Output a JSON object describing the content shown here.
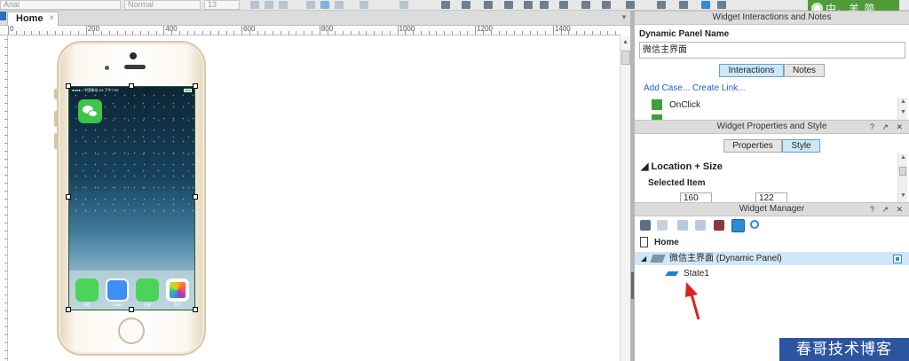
{
  "toolbar": {
    "font_family": "Arial",
    "font_style": "Normal",
    "font_size": "13"
  },
  "logo": {
    "text": "中。羊 简"
  },
  "document_tab": {
    "label": "Home",
    "close": "×"
  },
  "ruler": {
    "labels": [
      "0",
      "200",
      "400",
      "600",
      "800",
      "1000",
      "1200",
      "1400"
    ]
  },
  "phone": {
    "status_text": "●●●●○ 中国移动 4G     下午7:50",
    "dock_apps": [
      {
        "name": "phone-app",
        "label": "电话",
        "color": "#4cd35a"
      },
      {
        "name": "safari-app",
        "label": "Safari",
        "color": "#3b8ff5"
      },
      {
        "name": "messages-app",
        "label": "信息",
        "color": "#4cd35a"
      },
      {
        "name": "photos-app",
        "label": "照片",
        "color": "#ffffff"
      }
    ]
  },
  "interactions_panel": {
    "title": "Widget Interactions and Notes",
    "name_label": "Dynamic Panel Name",
    "name_value": "微信主界面",
    "tab_interactions": "Interactions",
    "tab_notes": "Notes",
    "add_case": "Add Case...",
    "create_link": "Create Link...",
    "onclick": "OnClick",
    "controls": "?  ↗ ✕"
  },
  "properties_panel": {
    "title": "Widget Properties and Style",
    "tab_properties": "Properties",
    "tab_style": "Style",
    "section": "Location + Size",
    "selected_item": "Selected Item",
    "x_value": "160",
    "y_value": "122",
    "controls": "?  ↗ ✕"
  },
  "widget_manager": {
    "title": "Widget Manager",
    "controls": "?  ↗ ✕",
    "page": "Home",
    "panel_item": "微信主界面 (Dynamic Panel)",
    "state_item": "State1"
  },
  "watermark": "春哥技术博客",
  "colors": {
    "accent": "#5aa7d6",
    "link": "#1d62c9",
    "arrow": "#e02020",
    "watermark_bg": "#2c55a0"
  }
}
